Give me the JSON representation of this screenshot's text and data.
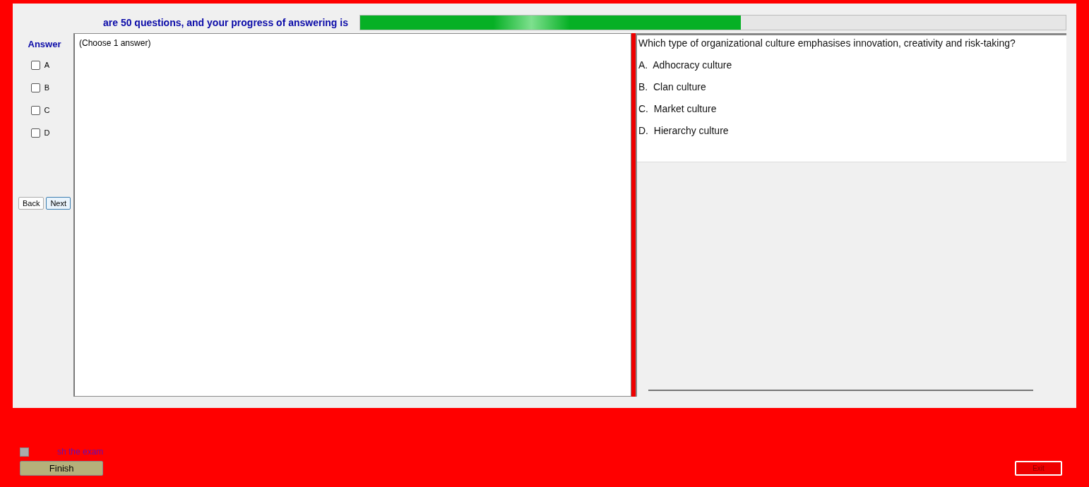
{
  "header": {
    "text": "are 50 questions, and your progress of answering is",
    "progress": {
      "level": 0.54
    }
  },
  "answer_panel": {
    "title": "Answer",
    "options": [
      {
        "label": "A",
        "checked": false
      },
      {
        "label": "B",
        "checked": false
      },
      {
        "label": "C",
        "checked": false
      },
      {
        "label": "D",
        "checked": false
      }
    ],
    "buttons": [
      {
        "label": "Back",
        "selected": false
      },
      {
        "label": "Next",
        "selected": true
      }
    ]
  },
  "answer_area": {
    "hint": "(Choose 1 answer)"
  },
  "question": {
    "text": "Which type of organizational culture emphasises innovation, creativity and risk-taking?",
    "choices": [
      "A.  Adhocracy culture",
      "B.  Clan culture",
      "C.  Market culture",
      "D.  Hierarchy culture"
    ]
  },
  "footer": {
    "finish_check": {
      "label": "sh the exam",
      "checked": false
    },
    "finish_button": "Finish",
    "exit_button": "Exit"
  }
}
